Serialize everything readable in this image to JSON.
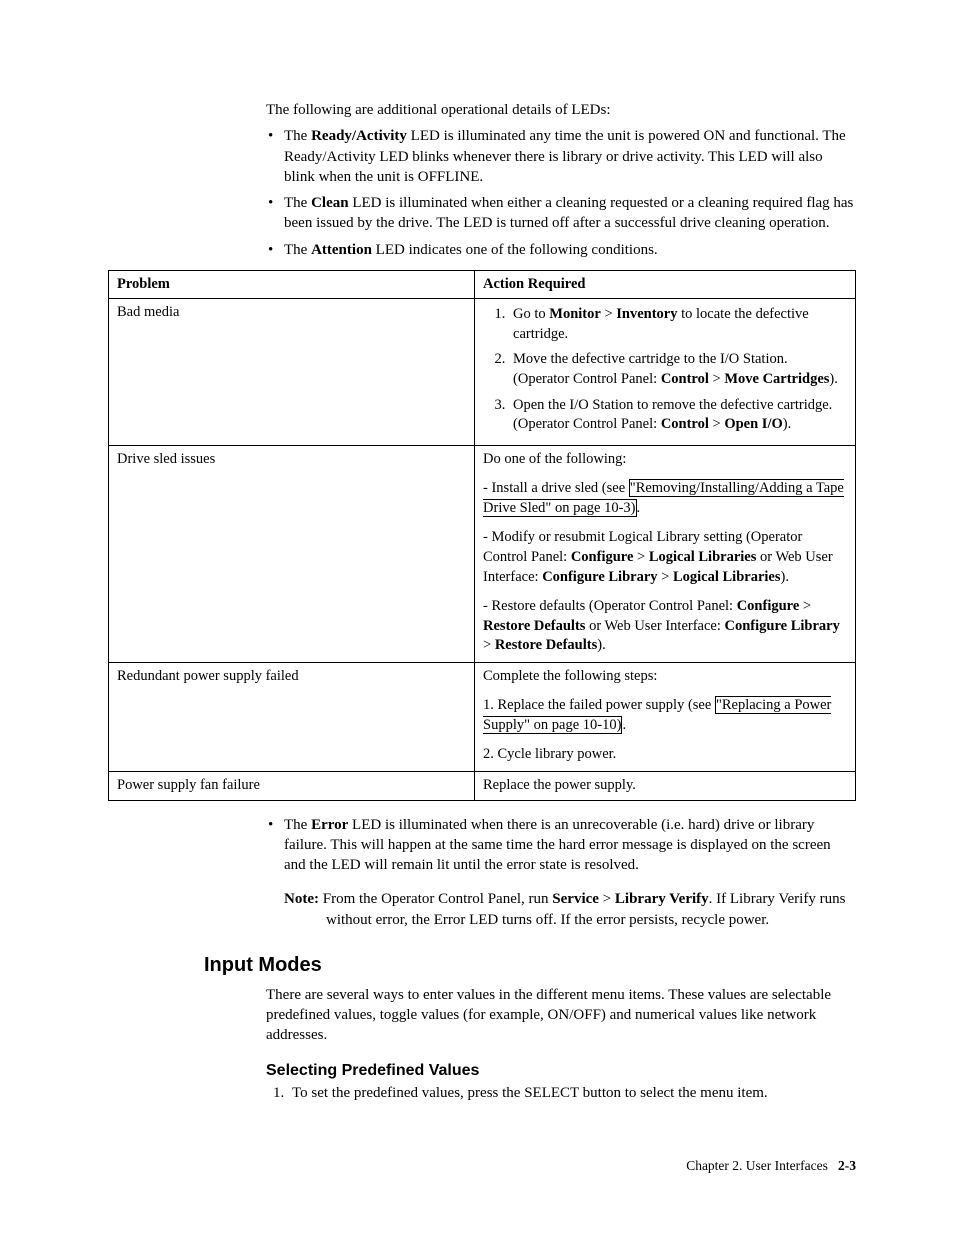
{
  "intro": "The following are additional operational details of LEDs:",
  "bullets1": [
    {
      "pre": "The ",
      "bold": "Ready/Activity",
      "post": " LED is illuminated any time the unit is powered ON and functional. The Ready/Activity LED blinks whenever there is library or drive activity. This LED will also blink when the unit is OFFLINE."
    },
    {
      "pre": "The ",
      "bold": "Clean",
      "post": " LED is illuminated when either a cleaning requested or a cleaning required flag has been issued by the drive. The LED is turned off after a successful drive cleaning operation."
    },
    {
      "pre": "The ",
      "bold": "Attention",
      "post": " LED indicates one of the following conditions."
    }
  ],
  "table": {
    "headers": {
      "c1": "Problem",
      "c2": "Action Required"
    },
    "rows": {
      "r1": {
        "problem": "Bad media",
        "steps": [
          {
            "pre": "Go to ",
            "b1": "Monitor",
            "sep": " > ",
            "b2": "Inventory",
            "post": " to locate the defective cartridge."
          },
          {
            "pre": "Move the defective cartridge to the I/O Station. (Operator Control Panel: ",
            "b1": "Control",
            "sep": " > ",
            "b2": "Move Cartridges",
            "post": ")."
          },
          {
            "pre": "Open the I/O Station to remove the defective cartridge. (Operator Control Panel: ",
            "b1": "Control",
            "sep": " > ",
            "b2": "Open I/O",
            "post": ")."
          }
        ]
      },
      "r2": {
        "problem": "Drive sled issues",
        "lead": "Do one of the following:",
        "p1a": "- Install a drive sled (see ",
        "p1link": "\"Removing/Installing/Adding a Tape Drive Sled\" on page 10-3)",
        "p1b": ".",
        "p2": "- Modify or resubmit Logical Library setting (Operator Control Panel: ",
        "p2b1": "Configure",
        "p2sep": " > ",
        "p2b2": "Logical Libraries",
        "p2mid": " or Web User Interface: ",
        "p2b3": "Configure Library",
        "p2sep2": " > ",
        "p2b4": "Logical Libraries",
        "p2end": ").",
        "p3": "- Restore defaults (Operator Control Panel: ",
        "p3b1": "Configure",
        "p3sep": " > ",
        "p3b2": "Restore Defaults",
        "p3mid": " or Web User Interface: ",
        "p3b3": "Configure Library",
        "p3sep2": " > ",
        "p3b4": "Restore Defaults",
        "p3end": ")."
      },
      "r3": {
        "problem": "Redundant power supply failed",
        "lead": "Complete the following steps:",
        "p1a": "1. Replace the failed power supply (see ",
        "p1link": "\"Replacing a Power Supply\" on page 10-10)",
        "p1b": ".",
        "p2": "2. Cycle library power."
      },
      "r4": {
        "problem": "Power supply fan failure",
        "action": "Replace the power supply."
      }
    }
  },
  "bullets2": {
    "pre": "The ",
    "bold": "Error",
    "post": " LED is illuminated when there is an unrecoverable (i.e. hard) drive or library failure. This will happen at the same time the hard error message is displayed on the screen and the LED will remain lit until the error state is resolved."
  },
  "note": {
    "label": "Note:",
    "pre": " From the Operator Control Panel, run ",
    "b1": "Service",
    "sep": " > ",
    "b2": "Library Verify",
    "post": ". If Library Verify runs without error, the Error LED turns off. If the error persists, recycle power."
  },
  "h2": "Input Modes",
  "h2_para": "There are several ways to enter values in the different menu items. These values are selectable predefined values, toggle values (for example, ON/OFF) and numerical values like network addresses.",
  "h3": "Selecting Predefined Values",
  "h3_step1": "To set the predefined values, press the SELECT button to select the menu item.",
  "footer": {
    "chapter": "Chapter 2. User Interfaces",
    "page": "2-3"
  }
}
